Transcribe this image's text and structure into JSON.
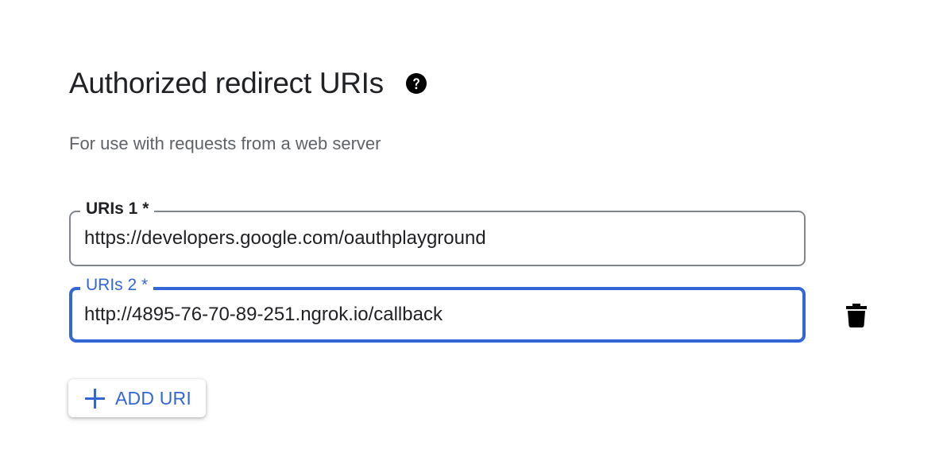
{
  "section": {
    "title": "Authorized redirect URIs",
    "help_icon": "help-circle-icon",
    "subtitle": "For use with requests from a web server"
  },
  "uris": [
    {
      "label": "URIs 1 *",
      "value": "https://developers.google.com/oauthplayground"
    },
    {
      "label": "URIs 2 *",
      "value": "http://4895-76-70-89-251.ngrok.io/callback"
    }
  ],
  "actions": {
    "delete_icon": "trash-icon",
    "add_label": "ADD URI",
    "add_icon": "plus-icon"
  },
  "colors": {
    "accent": "#3367d6",
    "text": "#202124",
    "secondary_text": "#5f6368",
    "border": "#80868b"
  }
}
